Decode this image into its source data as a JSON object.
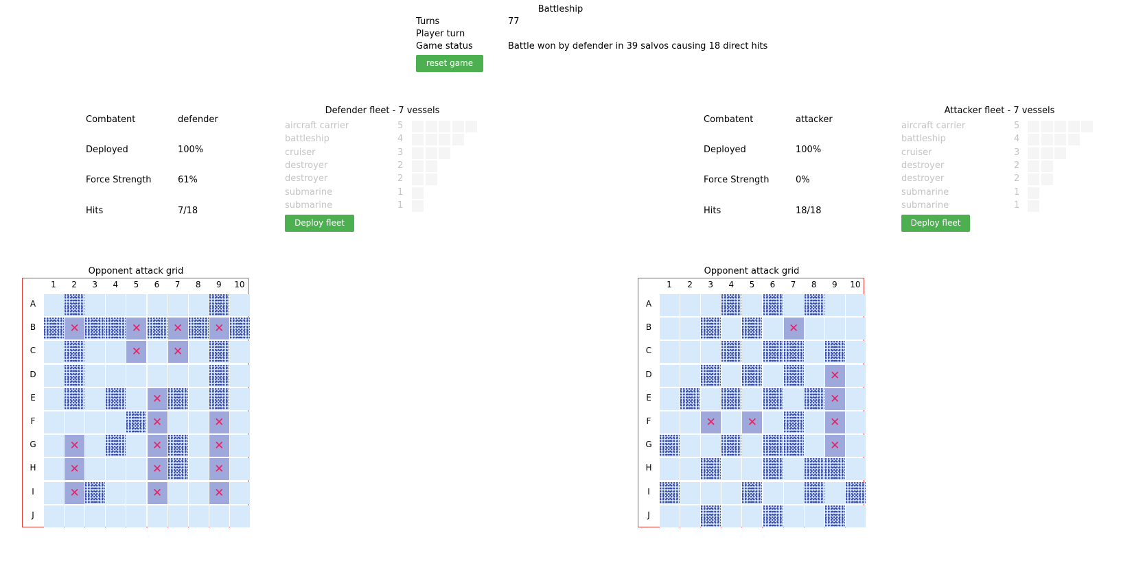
{
  "header": {
    "title": "Battleship",
    "rows": [
      {
        "label": "Turns",
        "value": "77"
      },
      {
        "label": "Player turn",
        "value": ""
      },
      {
        "label": "Game status",
        "value": "Battle won by defender in 39 salvos causing 18 direct hits"
      }
    ],
    "reset_label": "reset game"
  },
  "colors": {
    "button": "#4caf50",
    "water": "#d6eafc",
    "hit": "#9fa8da",
    "hit_mark": "#e91e63",
    "miss_pattern": "#3949ab",
    "grid_border": "#e53935"
  },
  "defender": {
    "stats": [
      {
        "label": "Combatent",
        "value": "defender"
      },
      {
        "label": "Deployed",
        "value": "100%"
      },
      {
        "label": "Force Strength",
        "value": "61%"
      },
      {
        "label": "Hits",
        "value": "7/18"
      }
    ],
    "fleet_title": "Defender fleet - 7 vessels",
    "deploy_label": "Deploy fleet",
    "vessels": [
      {
        "name": "aircraft carrier",
        "size": "5"
      },
      {
        "name": "battleship",
        "size": "4"
      },
      {
        "name": "cruiser",
        "size": "3"
      },
      {
        "name": "destroyer",
        "size": "2"
      },
      {
        "name": "destroyer",
        "size": "2"
      },
      {
        "name": "submarine",
        "size": "1"
      },
      {
        "name": "submarine",
        "size": "1"
      }
    ],
    "grid_title": "Opponent attack grid",
    "grid": [
      ". M . . . . . . M .",
      "M H M M H M H M H M",
      ". M . . H . H . M .",
      ". M . . . . . . M .",
      ". M . M . H M . M .",
      ". . . . M H . . H .",
      ". H . M . H M . H .",
      ". H . . . H M . H .",
      ". H M . . H . . H .",
      ". . . . . . . . . ."
    ]
  },
  "attacker": {
    "stats": [
      {
        "label": "Combatent",
        "value": "attacker"
      },
      {
        "label": "Deployed",
        "value": "100%"
      },
      {
        "label": "Force Strength",
        "value": "0%"
      },
      {
        "label": "Hits",
        "value": "18/18"
      }
    ],
    "fleet_title": "Attacker fleet - 7 vessels",
    "deploy_label": "Deploy fleet",
    "vessels": [
      {
        "name": "aircraft carrier",
        "size": "5"
      },
      {
        "name": "battleship",
        "size": "4"
      },
      {
        "name": "cruiser",
        "size": "3"
      },
      {
        "name": "destroyer",
        "size": "2"
      },
      {
        "name": "destroyer",
        "size": "2"
      },
      {
        "name": "submarine",
        "size": "1"
      },
      {
        "name": "submarine",
        "size": "1"
      }
    ],
    "grid_title": "Opponent attack grid",
    "grid": [
      ". . . M . M . M . .",
      ". . M . M . H . . .",
      ". . . M . M M . M .",
      ". . M . M . M . H .",
      ". M . M . M . M H .",
      ". . H . H . M . H .",
      "M . . M . M M . H .",
      ". . M . . M . M M .",
      "M . . . M . . M . M",
      ". . M . . M . . M ."
    ]
  },
  "grid_columns": [
    "1",
    "2",
    "3",
    "4",
    "5",
    "6",
    "7",
    "8",
    "9",
    "10"
  ],
  "grid_rows": [
    "A",
    "B",
    "C",
    "D",
    "E",
    "F",
    "G",
    "H",
    "I",
    "J"
  ]
}
